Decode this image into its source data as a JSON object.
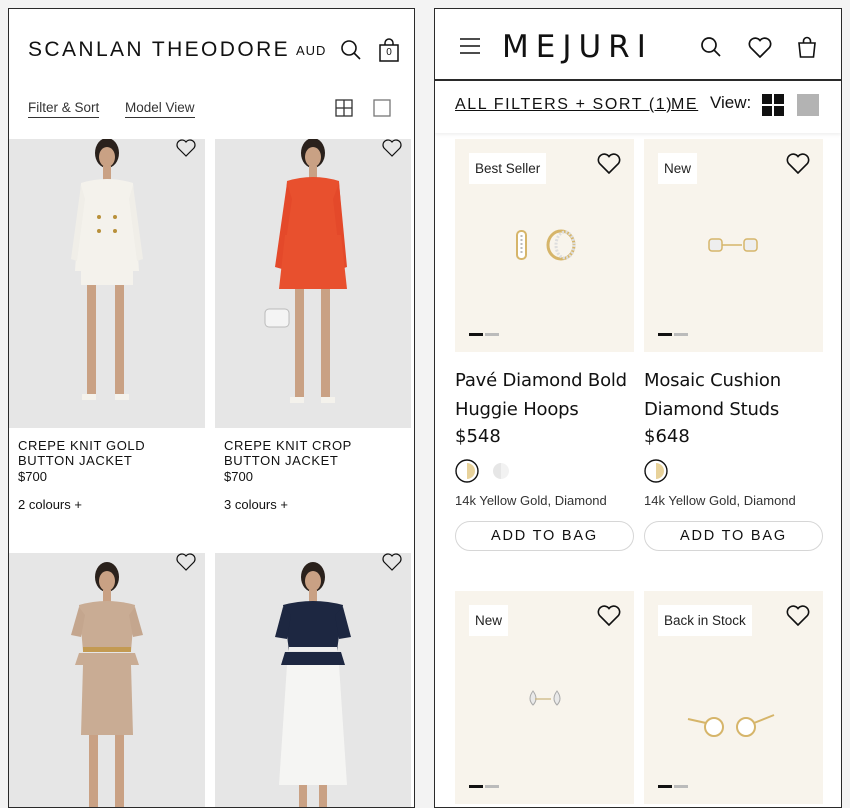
{
  "scanlan": {
    "logo": "SCANLAN THEODORE",
    "currency": "AUD",
    "bag_count": "0",
    "filter_label": "Filter & Sort",
    "model_view_label": "Model View",
    "products": [
      {
        "name": "CREPE KNIT GOLD BUTTON JACKET",
        "price": "$700",
        "colours": "2 colours +"
      },
      {
        "name": "CREPE KNIT CROP BUTTON JACKET",
        "price": "$700",
        "colours": "3 colours +"
      },
      {
        "name": "",
        "price": "",
        "colours": ""
      },
      {
        "name": "",
        "price": "",
        "colours": ""
      }
    ]
  },
  "mejuri": {
    "logo": "MEJURI",
    "filter_label": "ALL FILTERS + SORT (1)",
    "secondary_label": "ME",
    "view_label": "View:",
    "products": [
      {
        "badge": "Best Seller",
        "name_line1": "Pavé Diamond Bold",
        "name_line2": "Huggie Hoops",
        "price": "$548",
        "material": "14k Yellow Gold, Diamond",
        "button": "ADD TO BAG"
      },
      {
        "badge": "New",
        "name_line1": "Mosaic Cushion",
        "name_line2": "Diamond Studs",
        "price": "$648",
        "material": "14k Yellow Gold, Diamond",
        "button": "ADD TO BAG"
      },
      {
        "badge": "New"
      },
      {
        "badge": "Back in Stock"
      }
    ],
    "colors": {
      "background_tile": "#f8f4ec",
      "gold": "#e8d29a",
      "silver": "#d9d9d9"
    }
  }
}
